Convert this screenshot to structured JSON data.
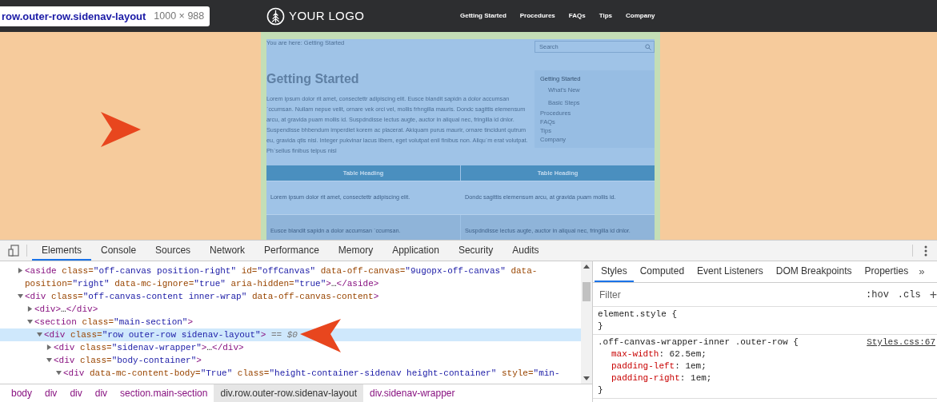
{
  "inspector_tooltip": {
    "selector": "row.outer-row.sidenav-layout",
    "size": "1000 × 988"
  },
  "site_header": {
    "logo_text": "YOUR LOGO",
    "nav": [
      "Getting Started",
      "Procedures",
      "FAQs",
      "Tips",
      "Company"
    ]
  },
  "page": {
    "breadcrumb": "You are here: Getting Started",
    "search": {
      "placeholder": "Search"
    },
    "heading": "Getting Started",
    "body": "Lorem ipsum dolor rit amet, consectettr adipiscing elit. Eusce blandit sapidn a dolor accumsan `ccumsan. Nullam nepue velit, ornare vek orci vel, mollis frhngilla mauris. Dondc sagittis elemensum arcu, at gravida puam mollis id. Suspdndisse lectus augte, auctor in aliqual nec, fringilla id dnlor. Suspendisse bhbendum imperdiet korem ac placerat. Akiquam purus maurir, ornare tincidunt qutrum eu, gravida qtis nisi. Integer pukvinar lacus libem, eget volutpat enil finibus non. Aliqu`m erat volutpat. Ph`sellus finibus telpus nisl",
    "sidenav": [
      {
        "label": "Getting Started",
        "selected": true,
        "children": [
          {
            "label": "What's New",
            "selected": false
          },
          {
            "label": "Basic Steps",
            "selected": false
          }
        ]
      },
      {
        "label": "Procedures",
        "selected": false
      },
      {
        "label": "FAQs",
        "selected": false
      },
      {
        "label": "Tips",
        "selected": false
      },
      {
        "label": "Company",
        "selected": false
      }
    ],
    "table": {
      "columns": [
        "Table Heading",
        "Table Heading"
      ],
      "rows": [
        [
          "Lorem ipsum dolor rit amet, consectettr adipiscing elit.",
          "Dondc sagittis elemensum arcu, at gravida puam mollis id."
        ],
        [
          "Eusce blandit sapidn a dolor accumsan `ccumsan.",
          "Suspdndisse lectus augte, auctor in aliqual nec, fringilla id dnlor."
        ]
      ]
    }
  },
  "devtools": {
    "tabs": [
      {
        "label": "Elements",
        "selected": true
      },
      {
        "label": "Console",
        "selected": false
      },
      {
        "label": "Sources",
        "selected": false
      },
      {
        "label": "Network",
        "selected": false
      },
      {
        "label": "Performance",
        "selected": false
      },
      {
        "label": "Memory",
        "selected": false
      },
      {
        "label": "Application",
        "selected": false
      },
      {
        "label": "Security",
        "selected": false
      },
      {
        "label": "Audits",
        "selected": false
      }
    ],
    "dom_tree": [
      {
        "tag": "<aside",
        "attrs": [
          {
            "name": "class=",
            "value": "\"off-canvas position-right\""
          },
          {
            "name": "id=",
            "value": "\"offCanvas\""
          },
          {
            "name": "data-off-canvas=",
            "value": "\"9ugopx-off-canvas\""
          },
          {
            "name": "data-position=",
            "value": "\"right\""
          },
          {
            "name": "data-mc-ignore=",
            "value": "\"true\""
          },
          {
            "name": "aria-hidden=",
            "value": "\"true\""
          }
        ],
        "end": ">",
        "collapsed": "…",
        "close": "</aside>",
        "expanded": false,
        "selected": false
      },
      {
        "tag": "<div",
        "attrs": [
          {
            "name": "class=",
            "value": "\"off-canvas-content inner-wrap\""
          },
          {
            "name": "data-off-canvas-content"
          }
        ],
        "end": ">",
        "expanded": true,
        "selected": false,
        "children": [
          {
            "tag": "<div",
            "end": ">",
            "collapsed": "…",
            "close": "</div>",
            "expanded": false,
            "selected": false
          },
          {
            "tag": "<section",
            "attrs": [
              {
                "name": "class=",
                "value": "\"main-section\""
              }
            ],
            "end": ">",
            "expanded": true,
            "selected": false,
            "children": [
              {
                "tag": "<div",
                "attrs": [
                  {
                    "name": "class=",
                    "value": "\"row outer-row sidenav-layout\""
                  }
                ],
                "end": ">",
                "marker": "== $0",
                "expanded": true,
                "selected": true,
                "children": [
                  {
                    "tag": "<div",
                    "attrs": [
                      {
                        "name": "class=",
                        "value": "\"sidenav-wrapper\""
                      }
                    ],
                    "end": ">",
                    "collapsed": "…",
                    "close": "</div>",
                    "expanded": false,
                    "selected": false
                  },
                  {
                    "tag": "<div",
                    "attrs": [
                      {
                        "name": "class=",
                        "value": "\"body-container\""
                      }
                    ],
                    "end": ">",
                    "expanded": true,
                    "selected": false,
                    "children": [
                      {
                        "tag": "<div",
                        "attrs": [
                          {
                            "name": "data-mc-content-body=",
                            "value": "\"True\""
                          },
                          {
                            "name": "class=",
                            "value": "\"height-container-sidenav height-container\""
                          },
                          {
                            "name": "style=",
                            "value": "\"min-"
                          }
                        ],
                        "expanded": true,
                        "selected": false
                      }
                    ]
                  }
                ]
              }
            ]
          }
        ]
      }
    ],
    "breadcrumbs": [
      {
        "label": "body",
        "selected": false
      },
      {
        "label": "div",
        "selected": false
      },
      {
        "label": "div",
        "selected": false
      },
      {
        "label": "div",
        "selected": false
      },
      {
        "label": "section.main-section",
        "selected": false
      },
      {
        "label": "div.row.outer-row.sidenav-layout",
        "selected": true
      },
      {
        "label": "div.sidenav-wrapper",
        "selected": false
      }
    ],
    "styles_tabs": [
      {
        "label": "Styles",
        "selected": true
      },
      {
        "label": "Computed",
        "selected": false
      },
      {
        "label": "Event Listeners",
        "selected": false
      },
      {
        "label": "DOM Breakpoints",
        "selected": false
      },
      {
        "label": "Properties",
        "selected": false
      }
    ],
    "more_tabs": "»",
    "filter": {
      "placeholder": "Filter"
    },
    "hov": ":hov",
    "cls": ".cls",
    "add": "+",
    "rules": [
      {
        "selector": "element.style {",
        "close": "}"
      },
      {
        "selector": ".off-canvas-wrapper-inner .outer-row {",
        "source": "Styles.css:67",
        "properties": [
          {
            "name": "max-width",
            "value": ": 62.5em;"
          },
          {
            "name": "padding-left",
            "value": ": 1em;"
          },
          {
            "name": "padding-right",
            "value": ": 1em;"
          }
        ],
        "close": "}"
      }
    ]
  }
}
